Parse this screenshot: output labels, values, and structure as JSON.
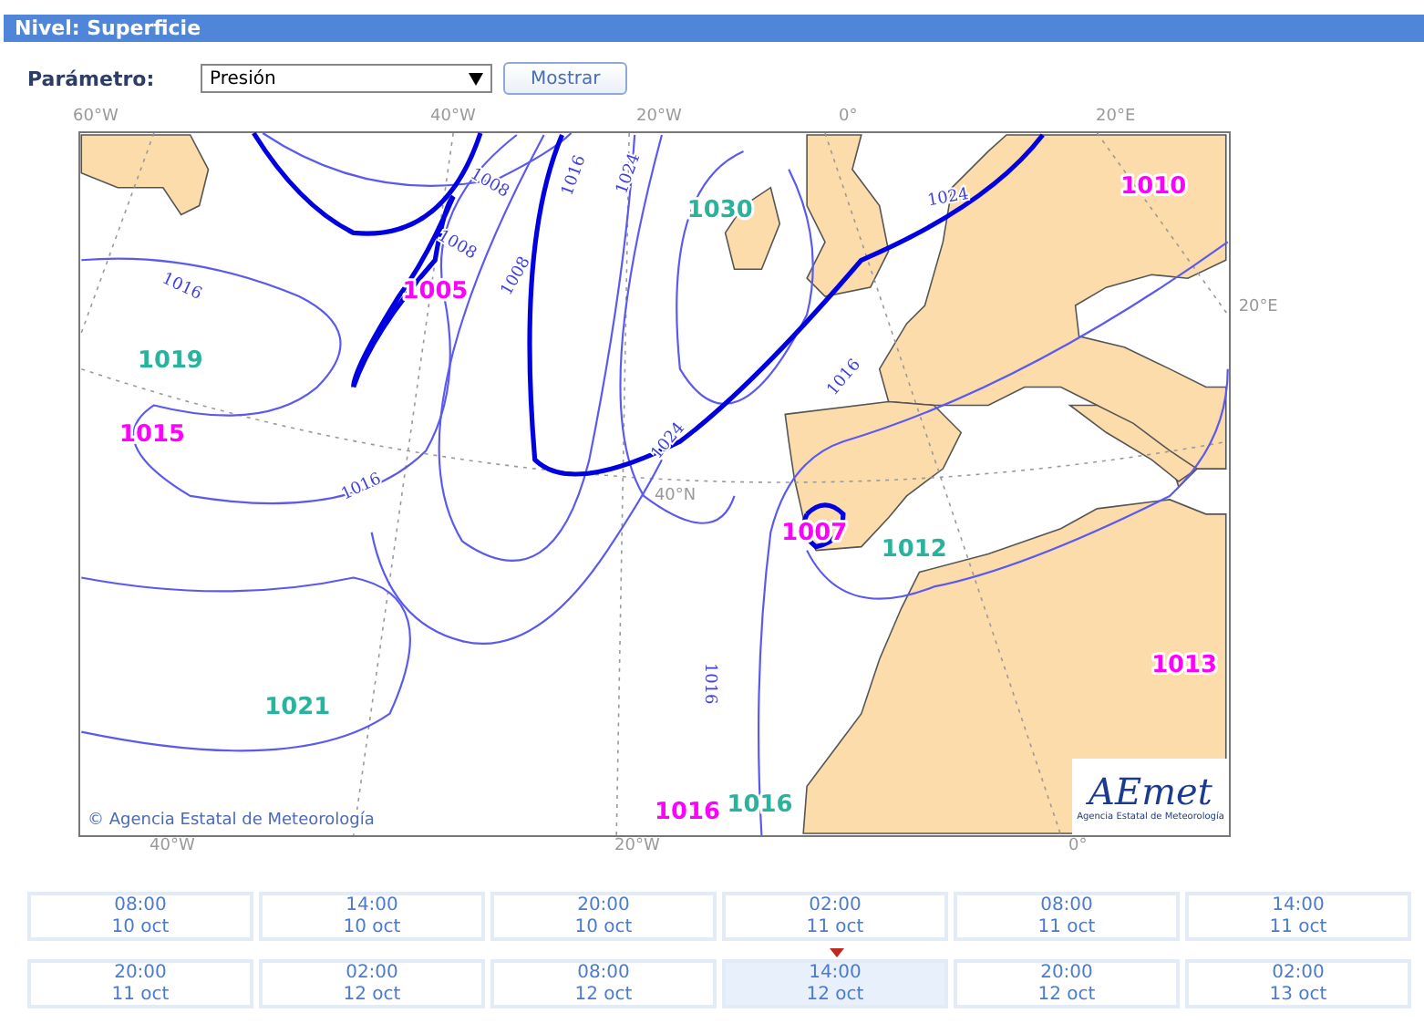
{
  "header": {
    "title": "Nivel: Superficie"
  },
  "parameter": {
    "label": "Parámetro:",
    "value": "Presión",
    "button": "Mostrar"
  },
  "map": {
    "top_axis": [
      "60°W",
      "40°W",
      "20°W",
      "0°",
      "20°E"
    ],
    "bottom_axis": [
      "40°W",
      "20°W",
      "0°"
    ],
    "pressure_centers": [
      {
        "value": "1010",
        "color": "#ff00ff"
      },
      {
        "value": "1030",
        "color": "#2ab39c"
      },
      {
        "value": "1005",
        "color": "#ff00ff"
      },
      {
        "value": "1019",
        "color": "#2ab39c"
      },
      {
        "value": "1015",
        "color": "#ff00ff"
      },
      {
        "value": "1007",
        "color": "#ff00ff"
      },
      {
        "value": "1012",
        "color": "#2ab39c"
      },
      {
        "value": "1013",
        "color": "#ff00ff"
      },
      {
        "value": "1021",
        "color": "#2ab39c"
      },
      {
        "value": "1016",
        "color": "#ff00ff"
      },
      {
        "value": "1016",
        "color": "#2ab39c"
      }
    ],
    "isobar_labels": [
      "1008",
      "1016",
      "1024",
      "1024",
      "1008",
      "1008",
      "1016",
      "1016",
      "1024",
      "1016",
      "1016"
    ],
    "grid_labels": [
      "20°E",
      "40°N"
    ],
    "credit": "© Agencia Estatal de Meteorología",
    "logo": {
      "name": "AEmet",
      "subtitle": "Agencia Estatal de Meteorología"
    }
  },
  "times": [
    {
      "time": "08:00",
      "date": "10 oct",
      "selected": false
    },
    {
      "time": "14:00",
      "date": "10 oct",
      "selected": false
    },
    {
      "time": "20:00",
      "date": "10 oct",
      "selected": false
    },
    {
      "time": "02:00",
      "date": "11 oct",
      "selected": false
    },
    {
      "time": "08:00",
      "date": "11 oct",
      "selected": false
    },
    {
      "time": "14:00",
      "date": "11 oct",
      "selected": false
    },
    {
      "time": "20:00",
      "date": "11 oct",
      "selected": false
    },
    {
      "time": "02:00",
      "date": "12 oct",
      "selected": false
    },
    {
      "time": "08:00",
      "date": "12 oct",
      "selected": false
    },
    {
      "time": "14:00",
      "date": "12 oct",
      "selected": true
    },
    {
      "time": "20:00",
      "date": "12 oct",
      "selected": false
    },
    {
      "time": "02:00",
      "date": "13 oct",
      "selected": false
    }
  ]
}
